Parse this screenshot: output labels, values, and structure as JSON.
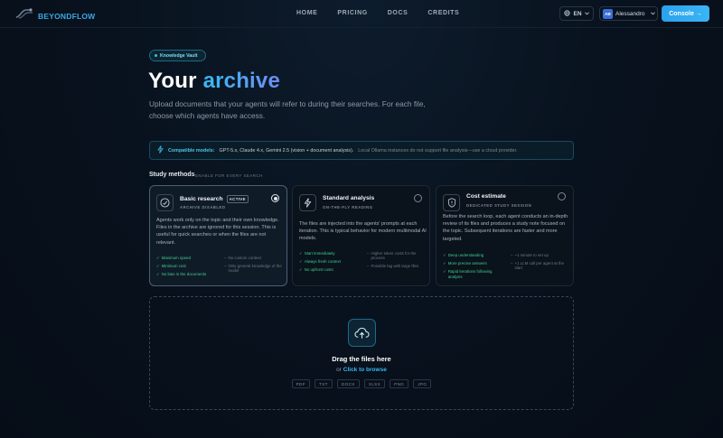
{
  "nav": {
    "brand": "BEYONDFLOW",
    "links": [
      "HOME",
      "PRICING",
      "DOCS",
      "CREDITS"
    ],
    "language": "EN",
    "user": {
      "initials": "AB",
      "name": "Alessandro"
    },
    "console_label": "Console →"
  },
  "hero": {
    "badge": "Knowledge Vault",
    "title_prefix": "Your",
    "title_accent": "archive",
    "subtitle": "Upload documents that your agents will refer to during their searches. For each file, choose which agents have access."
  },
  "info": {
    "label": "Compatible models:",
    "models": "GPT-5.x, Claude 4.x, Gemini 2.5 (vision + document analysis).",
    "note": "Local Ollama instances do not support file analysis—use a cloud provider."
  },
  "study_methods": {
    "label": "Study methods",
    "sublabel": "ENABLE FOR EVERY SEARCH",
    "cards": [
      {
        "title": "Basic research",
        "tag": "ACTIVE",
        "subtitle": "ARCHIVE DISABLED",
        "selected": true,
        "description": "Agents work only on the topic and their own knowledge. Files in the archive are ignored for this session. This is useful for quick searches or when the files are not relevant.",
        "pros": [
          "Maximum speed",
          "Minimum cost",
          "No bias in the documents"
        ],
        "cons": [
          "No custom context",
          "Only general knowledge of the model"
        ]
      },
      {
        "title": "Standard analysis",
        "tag": "",
        "subtitle": "ON-THE-FLY READING",
        "selected": false,
        "description": "The files are injected into the agents' prompts at each iteration. This is typical behavior for modern multimodal AI models.",
        "pros": [
          "Start immediately",
          "Always fresh context",
          "No upfront costs"
        ],
        "cons": [
          "Higher token costs for the process",
          "Possible lag with large files"
        ]
      },
      {
        "title": "Cost estimate",
        "tag": "",
        "subtitle": "DEDICATED STUDY SESSION",
        "selected": false,
        "description": "Before the search loop, each agent conducts an in-depth review of its files and produces a study note focused on the topic. Subsequent iterations are faster and more targeted.",
        "pros": [
          "Deep understanding",
          "More precise answers",
          "Rapid iterations following analysis"
        ],
        "cons": [
          "~1 minute to set up",
          "+1 LLM call per agent at the start"
        ]
      }
    ]
  },
  "dropzone": {
    "title": "Drag the files here",
    "or_text": "or",
    "browse_label": "Click to browse",
    "formats": [
      "PDF",
      "TXT",
      "DOCX",
      "XLSX",
      "PNG",
      "JPG"
    ]
  }
}
